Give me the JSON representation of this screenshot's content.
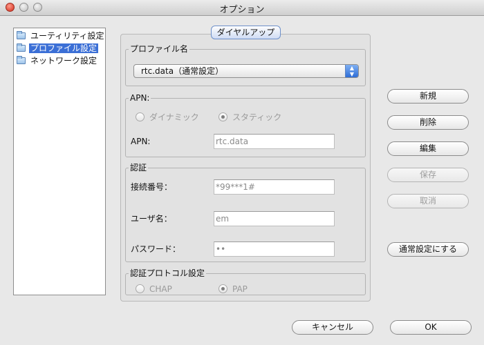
{
  "window": {
    "title": "オプション"
  },
  "tree": {
    "items": [
      {
        "label": "ユーティリティ設定",
        "selected": false
      },
      {
        "label": "プロファイル設定",
        "selected": true
      },
      {
        "label": "ネットワーク設定",
        "selected": false
      }
    ]
  },
  "panel": {
    "tab_label": "ダイヤルアップ"
  },
  "profile": {
    "group_label": "プロファイル名",
    "selected_value": "rtc.data（通常設定）"
  },
  "apn": {
    "group_label": "APN:",
    "radio_dynamic": "ダイナミック",
    "radio_static": "スタティック",
    "field_label": "APN:",
    "field_value": "rtc.data"
  },
  "auth": {
    "group_label": "認証",
    "number_label": "接続番号：",
    "number_value": "*99***1#",
    "user_label": "ユーザ名：",
    "user_value": "em",
    "password_label": "パスワード：",
    "password_value": "••"
  },
  "protocol": {
    "group_label": "認証プロトコル設定",
    "chap": "CHAP",
    "pap": "PAP"
  },
  "buttons": {
    "new": "新規",
    "delete": "削除",
    "edit": "編集",
    "save": "保存",
    "cancel_edit": "取消",
    "set_default": "通常設定にする",
    "cancel": "キャンセル",
    "ok": "OK"
  },
  "colors": {
    "selection": "#3b6fd6",
    "close_button": "#d12a1a"
  }
}
